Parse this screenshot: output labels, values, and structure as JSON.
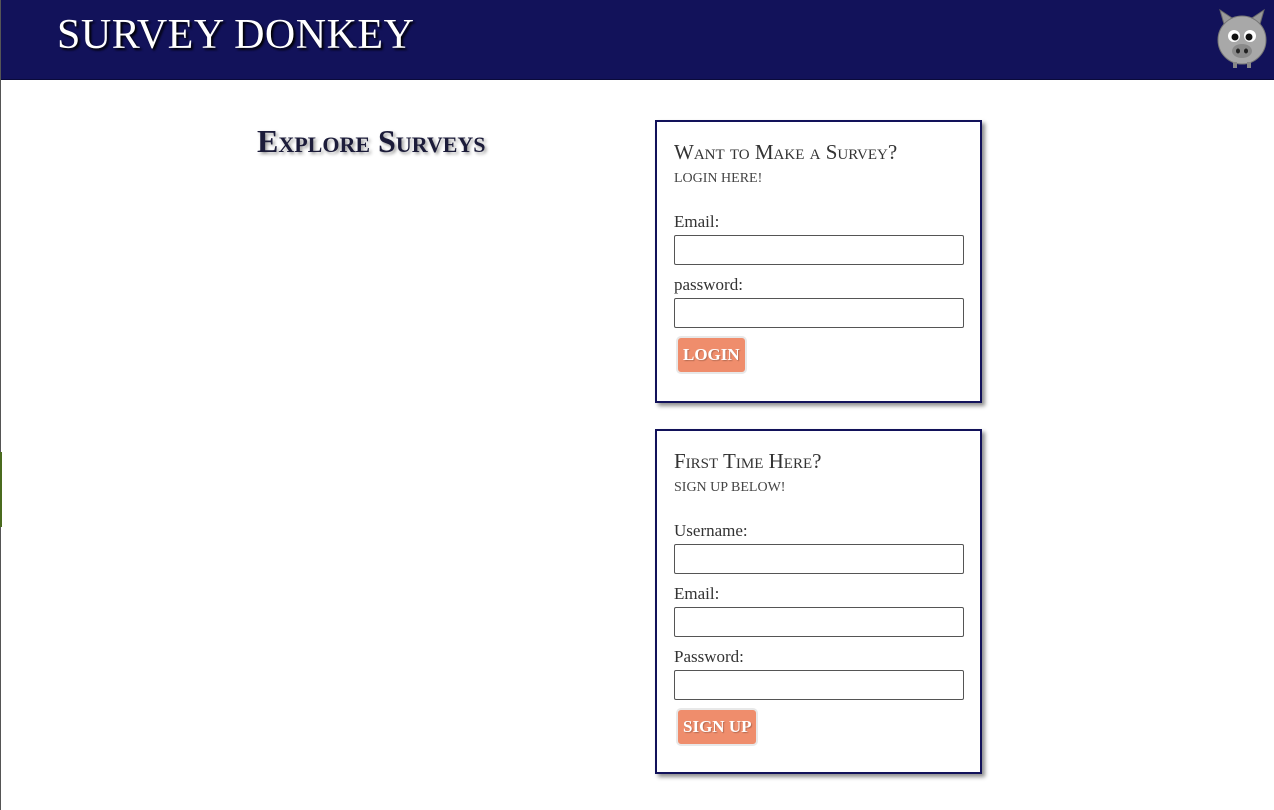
{
  "header": {
    "brand": "SURVEY DONKEY",
    "logo_icon": "donkey-icon",
    "background_color": "#12125a"
  },
  "main": {
    "explore_title": "Explore Surveys"
  },
  "login_card": {
    "title": "Want to Make a Survey?",
    "subtitle": "LOGIN HERE!",
    "email_label": "Email:",
    "email_value": "",
    "password_label": "password:",
    "password_value": "",
    "button_label": "LOGIN"
  },
  "signup_card": {
    "title": "First Time Here?",
    "subtitle": "SIGN UP BELOW!",
    "username_label": "Username:",
    "username_value": "",
    "email_label": "Email:",
    "email_value": "",
    "password_label": "Password:",
    "password_value": "",
    "button_label": "SIGN UP"
  },
  "colors": {
    "accent_button": "#ef8d6c",
    "card_border": "#12125a"
  }
}
